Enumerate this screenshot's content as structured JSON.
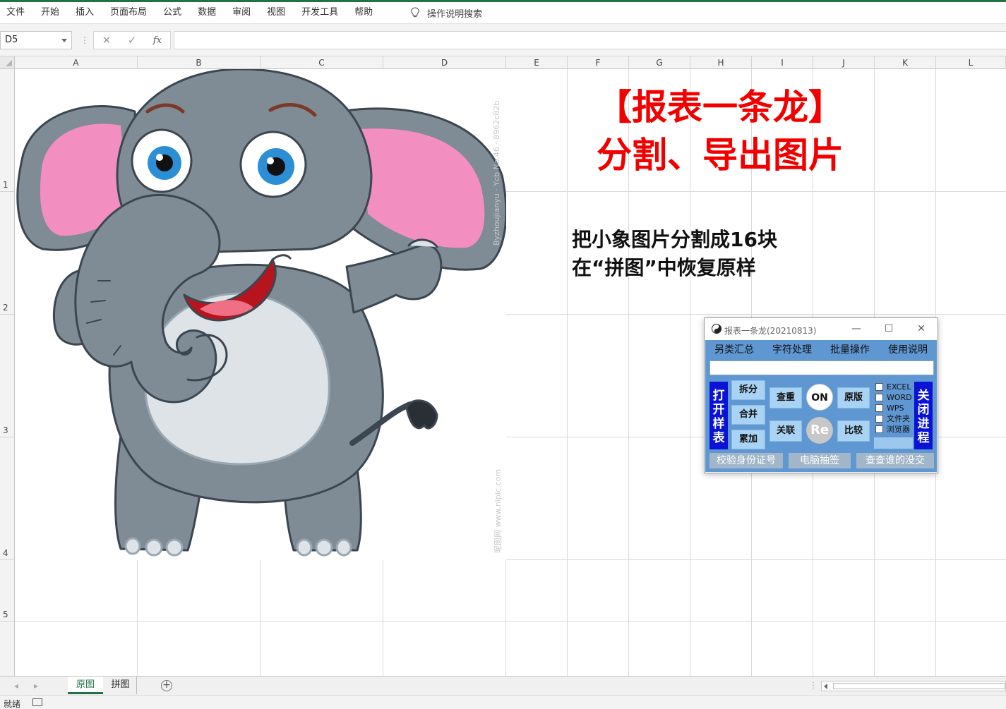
{
  "ribbon": {
    "menus": [
      "文件",
      "开始",
      "插入",
      "页面布局",
      "公式",
      "数据",
      "审阅",
      "视图",
      "开发工具",
      "帮助"
    ],
    "tell_me": "操作说明搜索"
  },
  "formula_bar": {
    "name_box": "D5",
    "formula": ""
  },
  "sheet": {
    "columns": [
      "A",
      "B",
      "C",
      "D",
      "E",
      "F",
      "G",
      "H",
      "I",
      "J",
      "K",
      "L"
    ],
    "rows": [
      "1",
      "2",
      "3",
      "4",
      "5"
    ]
  },
  "picture": {
    "watermark_1": "Byzhoujianyu · Ycb No.46 · 8962c82b",
    "watermark_2": "昵图网 www.nipic.com"
  },
  "content": {
    "title_line1": "【报表一条龙】",
    "title_line2": "分割、导出图片",
    "desc_line1": "把小象图片分割成16块",
    "desc_line2": "在“拼图”中恢复原样",
    "title_color": "#f20000"
  },
  "tool_window": {
    "title": "报表一条龙(20210813)",
    "menu": [
      "另类汇总",
      "字符处理",
      "批量操作",
      "使用说明"
    ],
    "input_value": "",
    "left_panel": "打开样表",
    "right_panel": "关闭进程",
    "buttons": {
      "split": "拆分",
      "merge": "合并",
      "accumulate": "累加",
      "dedupe": "查重",
      "link": "关联",
      "on": "ON",
      "re": "Re",
      "original": "原版",
      "compare": "比较"
    },
    "checkboxes": [
      "EXCEL",
      "WORD",
      "WPS",
      "文件夹",
      "浏览器"
    ],
    "bottom_buttons": [
      "校验身份证号",
      "电脑抽签",
      "查查谁的没交"
    ],
    "panel_color": "#5f97d2"
  },
  "sheet_tabs": [
    "原图",
    "拼图"
  ],
  "status": {
    "text": "就绪"
  },
  "theme": {
    "accent": "#217346"
  }
}
